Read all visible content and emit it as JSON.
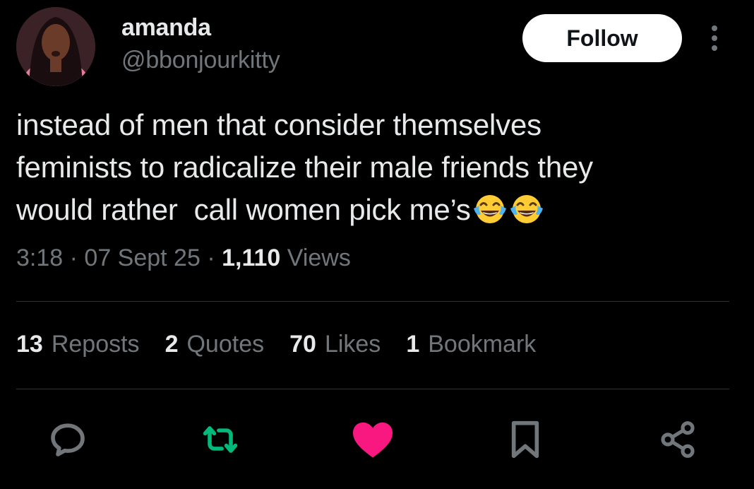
{
  "author": {
    "name": "amanda",
    "handle": "@bbonjourkitty"
  },
  "header": {
    "follow_label": "Follow"
  },
  "tweet": {
    "text_lines": [
      "instead of men that consider themselves",
      "feminists to radicalize their male friends they",
      "would rather  call women pick me’s"
    ],
    "emoji_after_text": [
      "face-with-tears-of-joy",
      "face-with-tears-of-joy"
    ]
  },
  "meta": {
    "time": "3:18",
    "sep1": " · ",
    "date": "07 Sept 25",
    "sep2": " · ",
    "views_count": "1,110",
    "views_label": " Views"
  },
  "stats": [
    {
      "count": "13",
      "label": "Reposts"
    },
    {
      "count": "2",
      "label": "Quotes"
    },
    {
      "count": "70",
      "label": "Likes"
    },
    {
      "count": "1",
      "label": "Bookmark"
    }
  ],
  "actions": {
    "reply_icon": "reply-icon",
    "repost_icon": "repost-icon",
    "like_icon": "heart-icon",
    "bookmark_icon": "bookmark-icon",
    "share_icon": "share-icon",
    "colors": {
      "repost_active": "#00ba7c",
      "like_active": "#f91880",
      "inactive": "#71767b"
    }
  }
}
